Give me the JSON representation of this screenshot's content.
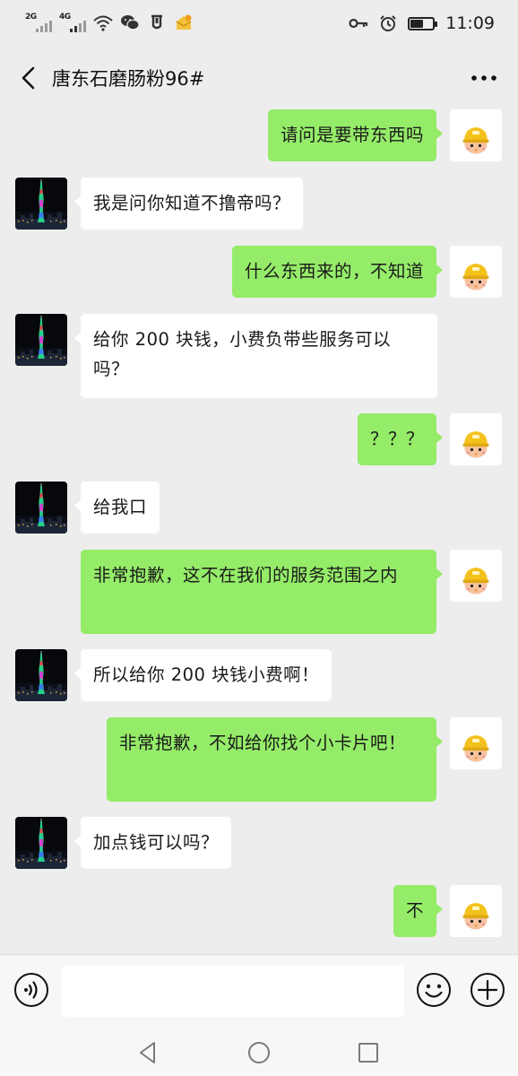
{
  "status_bar": {
    "sim1_network": "2G",
    "sim2_network": "4G",
    "time": "11:09",
    "battery_level": 0.6,
    "left_icons": [
      "signal-2g-icon",
      "signal-4g-icon",
      "wifi-icon",
      "wechat-notification-icon",
      "mailbox-notification-icon",
      "app-notification-icon"
    ],
    "right_icons": [
      "key-icon",
      "alarm-icon",
      "battery-icon"
    ]
  },
  "header": {
    "title": "唐东石磨肠粉96#",
    "back_icon": "chevron-left-icon",
    "more_icon": "more-dots-icon"
  },
  "colors": {
    "background": "#ededed",
    "self_bubble": "#95ec69",
    "other_bubble": "#ffffff",
    "bar_background": "#f7f7f7"
  },
  "messages": [
    {
      "sender": "self",
      "text": "请问是要带东西吗"
    },
    {
      "sender": "other",
      "text": "我是问你知道不撸帝吗？"
    },
    {
      "sender": "self",
      "text": "什么东西来的，不知道"
    },
    {
      "sender": "other",
      "text": "给你 200 块钱，小费负带些服务可以吗？"
    },
    {
      "sender": "self",
      "text": "？？？"
    },
    {
      "sender": "other",
      "text": "给我口"
    },
    {
      "sender": "self",
      "text": "非常抱歉，这不在我们的服务范围之内"
    },
    {
      "sender": "other",
      "text": "所以给你 200 块钱小费啊！"
    },
    {
      "sender": "self",
      "text": "非常抱歉，不如给你找个小卡片吧！"
    },
    {
      "sender": "other",
      "text": "加点钱可以吗？"
    },
    {
      "sender": "self",
      "text": "不"
    }
  ],
  "input_bar": {
    "placeholder": "",
    "icons": [
      "voice-icon",
      "emoji-icon",
      "plus-icon"
    ]
  },
  "nav_bar": {
    "icons": [
      "back-triangle-icon",
      "home-circle-icon",
      "recents-square-icon"
    ]
  }
}
